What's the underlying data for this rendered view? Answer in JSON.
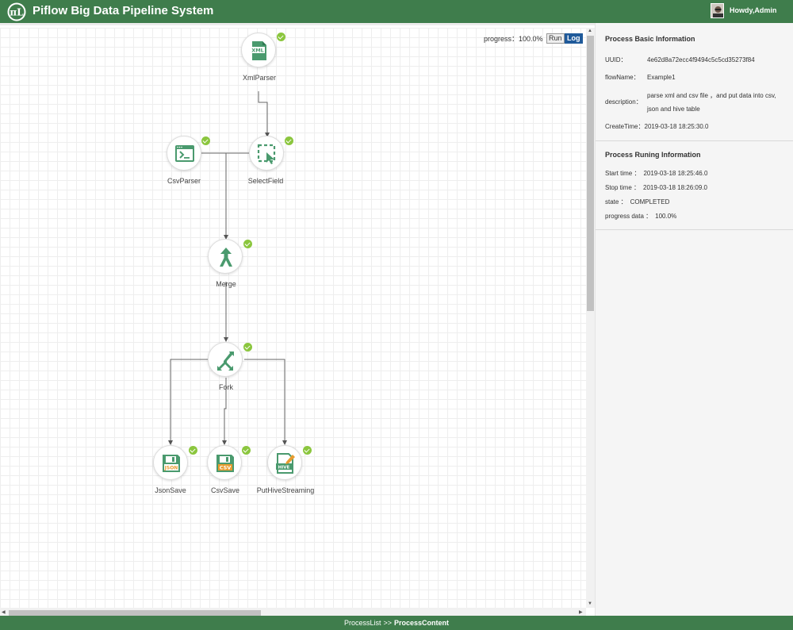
{
  "header": {
    "title": "Piflow Big Data Pipeline System",
    "user": "Howdy,Admin"
  },
  "toolbar": {
    "progress_label": "progress：",
    "progress_value": "100.0%",
    "run_label": "Run",
    "log_label": "Log"
  },
  "nodes": [
    {
      "id": "xml",
      "label": "XmlParser",
      "icon": "xml-file-icon"
    },
    {
      "id": "csvparser",
      "label": "CsvParser",
      "icon": "terminal-icon"
    },
    {
      "id": "select",
      "label": "SelectField",
      "icon": "select-cursor-icon"
    },
    {
      "id": "merge",
      "label": "Merge",
      "icon": "merge-arrows-icon"
    },
    {
      "id": "fork",
      "label": "Fork",
      "icon": "fork-arrows-icon"
    },
    {
      "id": "json",
      "label": "JsonSave",
      "icon": "save-json-icon",
      "badge": "JSON"
    },
    {
      "id": "csv",
      "label": "CsvSave",
      "icon": "save-csv-icon",
      "badge": "CSV"
    },
    {
      "id": "hive",
      "label": "PutHiveStreaming",
      "icon": "hive-edit-icon",
      "badge": "HIVE"
    }
  ],
  "basic_info": {
    "title": "Process Basic Information",
    "uuid_label": "UUID：",
    "uuid": "4e62d8a72ecc4f9494c5c5cd35273f84",
    "flowname_label": "flowName：",
    "flowname": "Example1",
    "description_label": "description：",
    "description_line1": "parse xml and csv file ，and put data into csv,",
    "description_line2": "json and hive table",
    "createtime_label": "CreateTime：",
    "createtime": "2019-03-18 18:25:30.0"
  },
  "running_info": {
    "title": "Process Runing Information",
    "start_label": "Start time ：",
    "start": "2019-03-18 18:25:46.0",
    "stop_label": "Stop time ：",
    "stop": "2019-03-18 18:26:09.0",
    "state_label": "state ：",
    "state": "COMPLETED",
    "progress_label": "progress data ：",
    "progress": "100.0%"
  },
  "footer": {
    "link": "ProcessList",
    "separator": ">>",
    "current": "ProcessContent"
  },
  "colors": {
    "brand": "#3f7d4c",
    "icon_green": "#4a9a6e",
    "check": "#8bc63e",
    "csv_orange": "#e89b2f"
  }
}
